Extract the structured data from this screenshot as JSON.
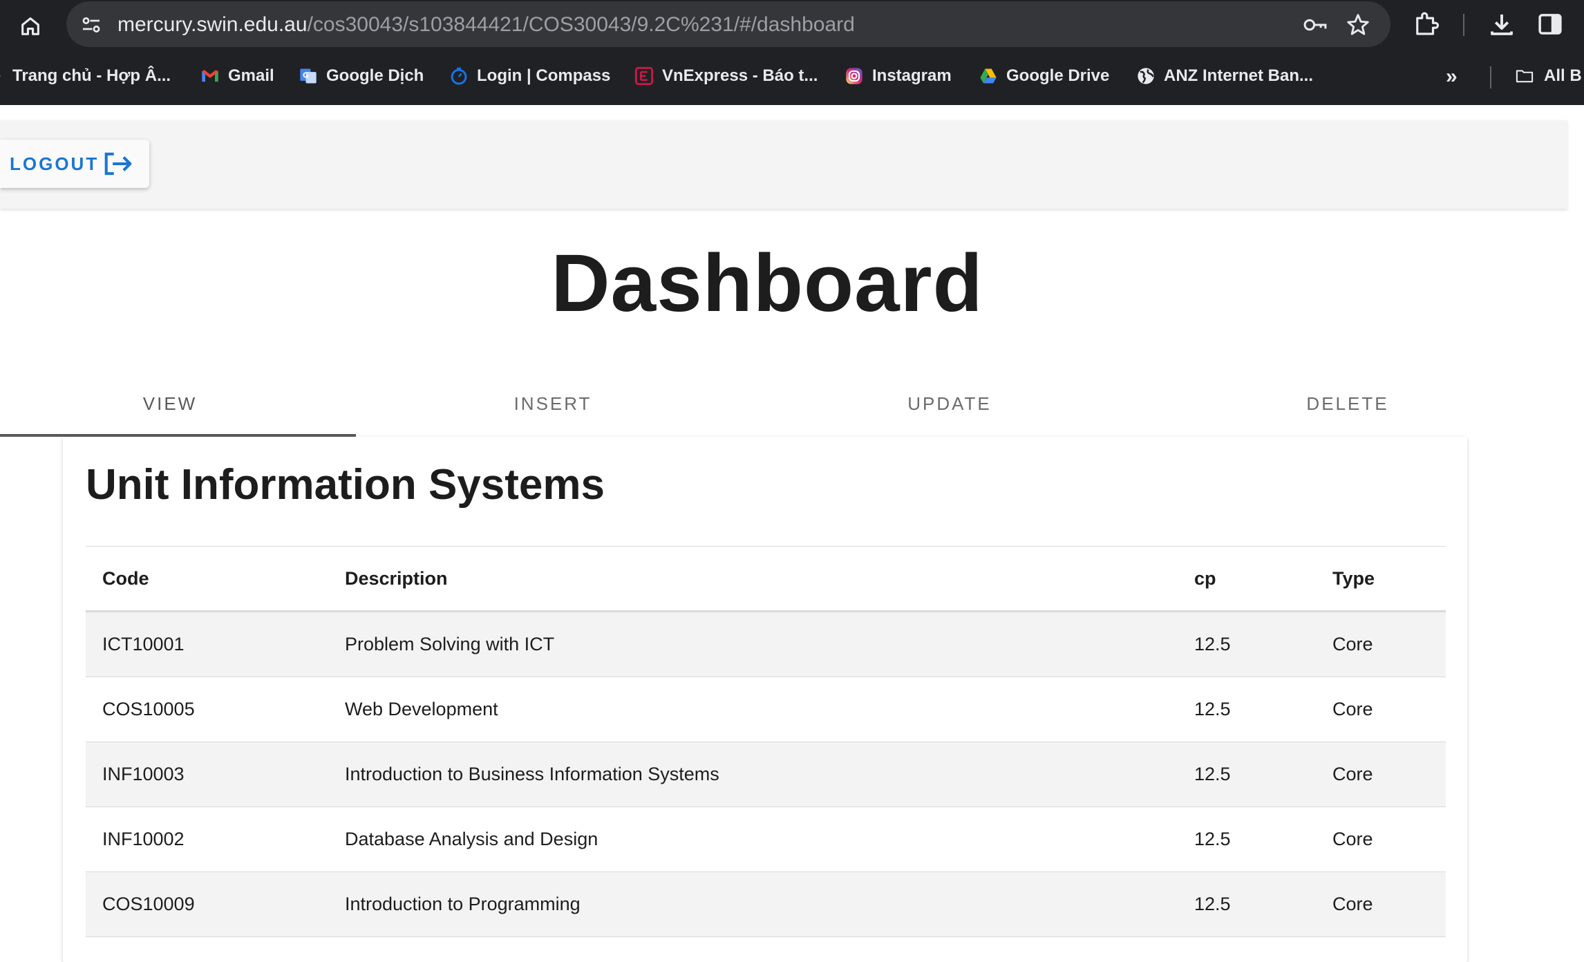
{
  "browser": {
    "url_host": "mercury.swin.edu.au",
    "url_path": "/cos30043/s103844421/COS30043/9.2C%231/#/dashboard",
    "bookmarks": [
      {
        "label": "Trang chủ - Hợp Â...",
        "icon": "play-icon"
      },
      {
        "label": "Gmail",
        "icon": "gmail-icon"
      },
      {
        "label": "Google Dịch",
        "icon": "google-translate-icon"
      },
      {
        "label": "Login | Compass",
        "icon": "compass-icon"
      },
      {
        "label": "VnExpress - Báo t...",
        "icon": "vnexpress-icon"
      },
      {
        "label": "Instagram",
        "icon": "instagram-icon"
      },
      {
        "label": "Google Drive",
        "icon": "google-drive-icon"
      },
      {
        "label": "ANZ Internet Ban...",
        "icon": "globe-icon"
      }
    ],
    "more": "»",
    "all_bookmarks_label": "All B"
  },
  "header": {
    "logout_label": "LOGOUT"
  },
  "page": {
    "title": "Dashboard"
  },
  "tabs": [
    {
      "label": "VIEW",
      "active": true
    },
    {
      "label": "INSERT",
      "active": false
    },
    {
      "label": "UPDATE",
      "active": false
    },
    {
      "label": "DELETE",
      "active": false
    }
  ],
  "card": {
    "title": "Unit Information Systems",
    "columns": [
      "Code",
      "Description",
      "cp",
      "Type"
    ],
    "rows": [
      [
        "ICT10001",
        "Problem Solving with ICT",
        "12.5",
        "Core"
      ],
      [
        "COS10005",
        "Web Development",
        "12.5",
        "Core"
      ],
      [
        "INF10003",
        "Introduction to Business Information Systems",
        "12.5",
        "Core"
      ],
      [
        "INF10002",
        "Database Analysis and Design",
        "12.5",
        "Core"
      ],
      [
        "COS10009",
        "Introduction to Programming",
        "12.5",
        "Core"
      ]
    ]
  },
  "colors": {
    "accent": "#1976d2",
    "chrome_bg": "#202124",
    "omnibox_bg": "#35363a"
  }
}
